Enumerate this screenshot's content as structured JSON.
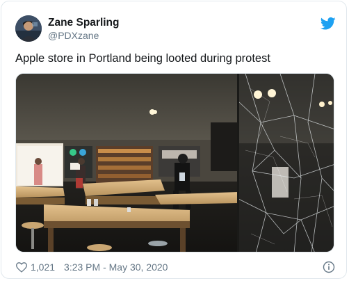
{
  "tweet": {
    "display_name": "Zane Sparling",
    "handle": "@PDXzane",
    "text": "Apple store in Portland being looted during protest",
    "like_count": "1,021",
    "timestamp": "3:23 PM - May 30, 2020"
  },
  "colors": {
    "twitter_blue": "#1da1f2",
    "secondary_text": "#657786",
    "border": "#e1e8ed"
  },
  "icons": {
    "brand": "twitter-bird-icon",
    "like": "heart-icon",
    "info": "info-icon"
  }
}
